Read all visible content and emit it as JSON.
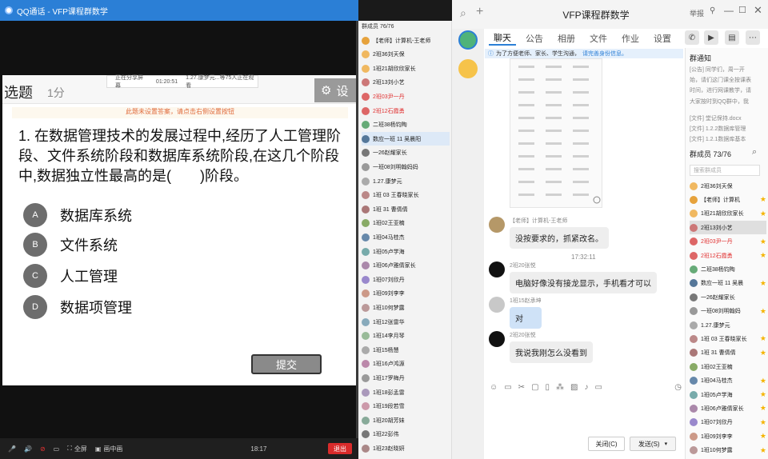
{
  "left_app": {
    "title": "QQ通话 - VFP课程群数学",
    "share_bar": {
      "status": "正在分享屏幕",
      "time": "01:20:51",
      "viewers": "1.27.康梦元...等75人正在观看"
    },
    "slide": {
      "type_label": "选题",
      "score": "1分",
      "settings_label": "设",
      "warning": "此题未设置答案，请点击右侧设置按钮",
      "question": "1. 在数据管理技术的发展过程中,经历了人工管理阶段、文件系统阶段和数据库系统阶段,在这几个阶段中,数据独立性最高的是(　　)阶段。",
      "options": [
        {
          "letter": "A",
          "text": "数据库系统"
        },
        {
          "letter": "B",
          "text": "文件系统"
        },
        {
          "letter": "C",
          "text": "人工管理"
        },
        {
          "letter": "D",
          "text": "数据项管理"
        }
      ],
      "submit_label": "提交"
    },
    "bottom_bar": {
      "fullscreen": "全屏",
      "picture_in_picture": "画中画",
      "time": "18:17",
      "exit": "退出"
    }
  },
  "member_list": {
    "title": "群成员 76/76",
    "items": [
      {
        "name": "【老师】计算机-王老师",
        "color": "#e6a23c",
        "red": false
      },
      {
        "name": "2班36刘天保",
        "color": "#f0b860",
        "red": false
      },
      {
        "name": "1班21胡欣欣家长",
        "color": "#f0b860",
        "red": false
      },
      {
        "name": "2班13刘小艺",
        "color": "#c77",
        "red": false
      },
      {
        "name": "2班03尹一丹",
        "color": "#d66",
        "red": true
      },
      {
        "name": "2班12石霞勇",
        "color": "#d66",
        "red": true
      },
      {
        "name": "二班38杨钧陶",
        "color": "#6a7",
        "red": false
      },
      {
        "name": "数应一班 11 吴晨阳",
        "color": "#579",
        "red": false
      },
      {
        "name": "一26赵耀家长",
        "color": "#777",
        "red": false
      },
      {
        "name": "一班08刘明翰妈妈",
        "color": "#999",
        "red": false
      },
      {
        "name": "1.27.康梦元",
        "color": "#aaa",
        "red": false
      },
      {
        "name": "1班 03 王春晓家长",
        "color": "#b88",
        "red": false
      },
      {
        "name": "1班 31 曹倩倩",
        "color": "#a77",
        "red": false
      },
      {
        "name": "1班02王亚楠",
        "color": "#8a6",
        "red": false
      },
      {
        "name": "1班04马桂杰",
        "color": "#68a",
        "red": false
      },
      {
        "name": "1班05卢学海",
        "color": "#7aa",
        "red": false
      },
      {
        "name": "1班06卢雅倩家长",
        "color": "#a8a",
        "red": false
      },
      {
        "name": "1班07刘欣丹",
        "color": "#98c",
        "red": false
      },
      {
        "name": "1班09刘李李",
        "color": "#c98",
        "red": false
      },
      {
        "name": "1班10何梦露",
        "color": "#b99",
        "red": false
      },
      {
        "name": "1班12张雷华",
        "color": "#8ab",
        "red": false
      },
      {
        "name": "1班14李月琴",
        "color": "#9b9",
        "red": false
      },
      {
        "name": "1班15杨慧",
        "color": "#aaa",
        "red": false
      },
      {
        "name": "1班16卢鸿源",
        "color": "#b8a",
        "red": false
      },
      {
        "name": "1班17罗梅丹",
        "color": "#999",
        "red": false
      },
      {
        "name": "1班18彭孟雷",
        "color": "#a9b",
        "red": false
      },
      {
        "name": "1班19段若雪",
        "color": "#c9a",
        "red": false
      },
      {
        "name": "1班20胡芳妹",
        "color": "#8a9",
        "red": false
      },
      {
        "name": "1班22彭伟",
        "color": "#777",
        "red": false
      },
      {
        "name": "1班23赵晓妍",
        "color": "#a88",
        "red": false
      }
    ]
  },
  "chat": {
    "title": "VFP课程群数学",
    "title_right": "举报",
    "tabs": [
      "聊天",
      "公告",
      "相册",
      "文件",
      "作业",
      "设置"
    ],
    "notice": {
      "text": "为了方便老师、家长、学生沟通，",
      "link": "请完善身份信息。"
    },
    "messages": [
      {
        "sender": "【老师】计算机-王老师",
        "text": "没按要求的，抓紧改名。",
        "style": "grey"
      },
      {
        "sender": "2班20张悦",
        "text": "电脑好像没有接龙显示，手机看才可以",
        "style": "grey"
      },
      {
        "sender": "1班15赵承坤",
        "text": "对",
        "style": "blue"
      },
      {
        "sender": "2班20张悦",
        "text": "我说我刚怎么没看到",
        "style": "grey"
      }
    ],
    "timestamp": "17:32:11",
    "close_label": "关闭(C)",
    "send_label": "发送(S)"
  },
  "right_panel": {
    "notice_title": "群通知",
    "notes": [
      "[公告] 同学们，周一开",
      "始，请们这门课全按课表",
      "时间，进行网课教学，请",
      "大家按时到QQ群中，我",
      "[文件] 堂记保持.docx",
      "[文件] 1.2.2数据库管理",
      "[文件] 1.2.1数据库基本"
    ],
    "members_title": "群成员 73/76",
    "search_placeholder": "搜索群成员",
    "members": [
      {
        "name": "2班36刘天保",
        "color": "#f0b860",
        "red": false,
        "star": false
      },
      {
        "name": "【老师】计算机",
        "color": "#e6a23c",
        "red": false,
        "star": true
      },
      {
        "name": "1班21胡欣欣家长",
        "color": "#f0b860",
        "red": false,
        "star": true
      },
      {
        "name": "2班13刘小艺",
        "color": "#c77",
        "red": false,
        "star": false
      },
      {
        "name": "2班03尹一丹",
        "color": "#d66",
        "red": true,
        "star": true
      },
      {
        "name": "2班12石霞勇",
        "color": "#d66",
        "red": true,
        "star": true
      },
      {
        "name": "二班38杨钧陶",
        "color": "#6a7",
        "red": false,
        "star": false
      },
      {
        "name": "数应一班 11 吴晨",
        "color": "#579",
        "red": false,
        "star": true
      },
      {
        "name": "一26赵耀家长",
        "color": "#777",
        "red": false,
        "star": false
      },
      {
        "name": "一班08刘明翰妈",
        "color": "#999",
        "red": false,
        "star": true
      },
      {
        "name": "1.27.康梦元",
        "color": "#aaa",
        "red": false,
        "star": false
      },
      {
        "name": "1班 03 王春晓家长",
        "color": "#b88",
        "red": false,
        "star": true
      },
      {
        "name": "1班 31 曹倩倩",
        "color": "#a77",
        "red": false,
        "star": true
      },
      {
        "name": "1班02王亚楠",
        "color": "#8a6",
        "red": false,
        "star": false
      },
      {
        "name": "1班04马桂杰",
        "color": "#68a",
        "red": false,
        "star": true
      },
      {
        "name": "1班05卢学海",
        "color": "#7aa",
        "red": false,
        "star": true
      },
      {
        "name": "1班06卢雅倩家长",
        "color": "#a8a",
        "red": false,
        "star": true
      },
      {
        "name": "1班07刘欣丹",
        "color": "#98c",
        "red": false,
        "star": true
      },
      {
        "name": "1班09刘李李",
        "color": "#c98",
        "red": false,
        "star": true
      },
      {
        "name": "1班10何梦露",
        "color": "#b99",
        "red": false,
        "star": true
      }
    ]
  }
}
